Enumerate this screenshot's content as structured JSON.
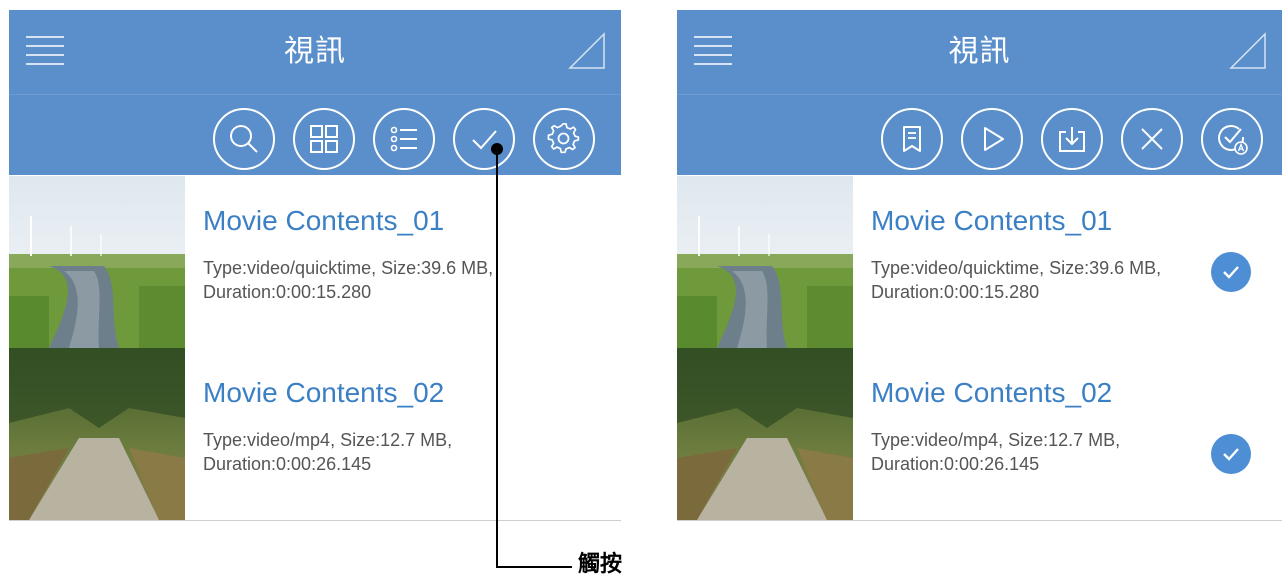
{
  "left_panel": {
    "title": "視訊",
    "toolbar": [
      {
        "icon": "search-icon"
      },
      {
        "icon": "grid-view-icon"
      },
      {
        "icon": "list-view-icon"
      },
      {
        "icon": "select-check-icon"
      },
      {
        "icon": "settings-gear-icon"
      }
    ],
    "items": [
      {
        "title": "Movie Contents_01",
        "detail": "Type:video/quicktime, Size:39.6 MB, Duration:0:00:15.280"
      },
      {
        "title": "Movie Contents_02",
        "detail": "Type:video/mp4, Size:12.7 MB, Duration:0:00:26.145"
      }
    ]
  },
  "right_panel": {
    "title": "視訊",
    "toolbar": [
      {
        "icon": "playlist-icon"
      },
      {
        "icon": "play-icon"
      },
      {
        "icon": "download-icon"
      },
      {
        "icon": "close-icon"
      },
      {
        "icon": "select-all-icon"
      }
    ],
    "items": [
      {
        "title": "Movie Contents_01",
        "detail": "Type:video/quicktime, Size:39.6 MB, Duration:0:00:15.280",
        "selected": true
      },
      {
        "title": "Movie Contents_02",
        "detail": "Type:video/mp4, Size:12.7 MB, Duration:0:00:26.145",
        "selected": true
      }
    ]
  },
  "annotation": {
    "label": "觸按"
  },
  "colors": {
    "header": "#5b8fcb",
    "title_text": "#3b7fc4",
    "check_badge": "#4d8ed4"
  }
}
